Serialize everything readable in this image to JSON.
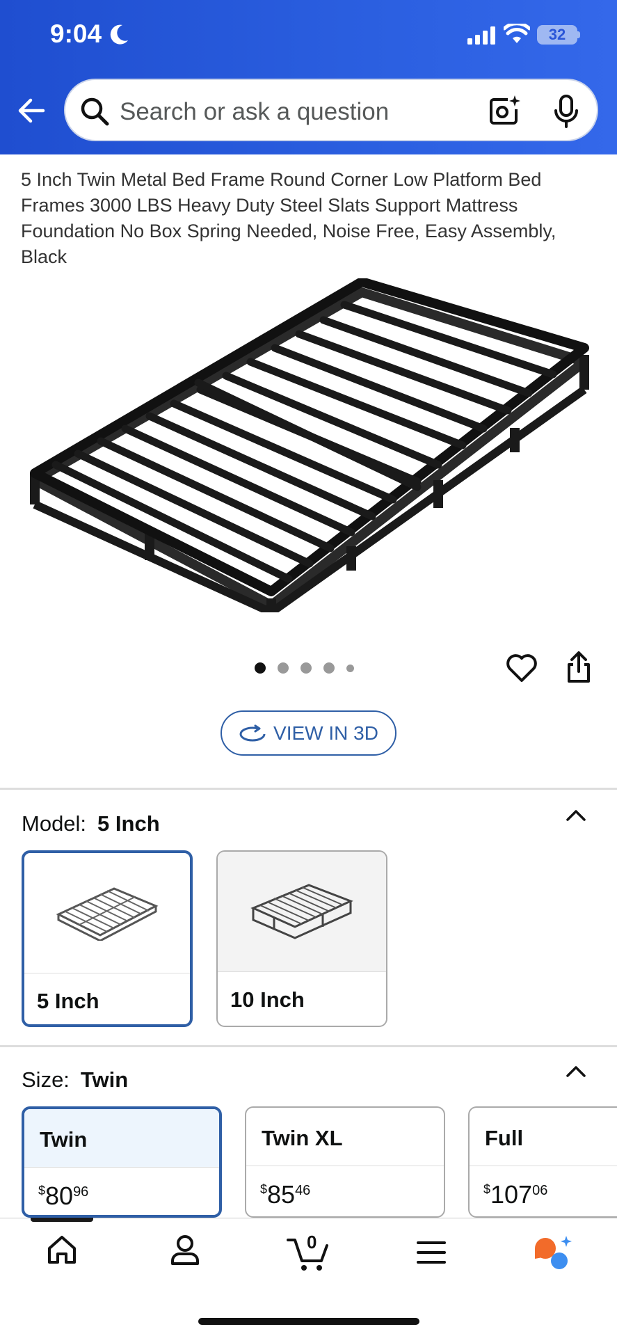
{
  "status_bar": {
    "time": "9:04",
    "battery": "32"
  },
  "search": {
    "placeholder": "Search or ask a question"
  },
  "product": {
    "title": "5 Inch Twin Metal Bed Frame Round Corner Low Platform Bed Frames 3000 LBS Heavy Duty Steel Slats Support Mattress Foundation No Box Spring Needed, Noise Free, Easy Assembly, Black",
    "image_count": 5,
    "active_image": 1,
    "view_3d_label": "VIEW IN 3D"
  },
  "model": {
    "label": "Model:",
    "selected": "5 Inch",
    "options": [
      {
        "label": "5 Inch",
        "selected": true
      },
      {
        "label": "10 Inch",
        "selected": false
      }
    ]
  },
  "size": {
    "label": "Size:",
    "selected": "Twin",
    "options": [
      {
        "label": "Twin",
        "price_symbol": "$",
        "price_whole": "80",
        "price_cents": "96",
        "selected": true
      },
      {
        "label": "Twin XL",
        "price_symbol": "$",
        "price_whole": "85",
        "price_cents": "46",
        "selected": false
      },
      {
        "label": "Full",
        "price_symbol": "$",
        "price_whole": "107",
        "price_cents": "06",
        "selected": false
      }
    ]
  },
  "bottom_nav": {
    "cart_count": "0",
    "items": [
      "home-icon",
      "account-icon",
      "cart-icon",
      "menu-icon",
      "rufus-ai-icon"
    ]
  },
  "colors": {
    "header_blue": "#2b5fe0",
    "selected_border": "#2f5fa6",
    "selected_fill": "#edf5fd"
  }
}
